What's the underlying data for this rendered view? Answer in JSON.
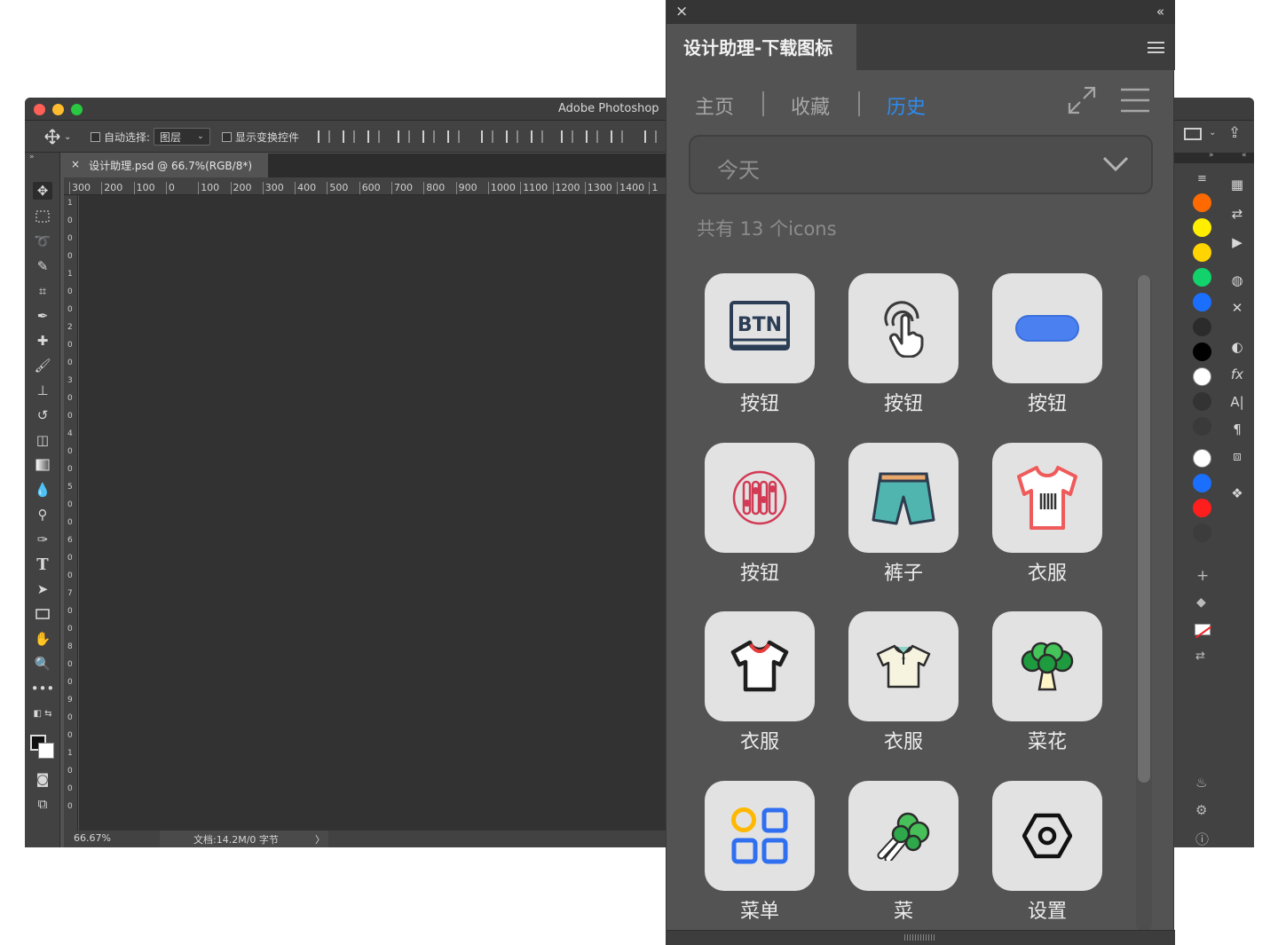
{
  "photoshop": {
    "app_title": "Adobe Photoshop",
    "options": {
      "auto_select_label": "自动选择:",
      "layer_select_value": "图层",
      "show_transform_label": "显示变换控件"
    },
    "doc_tab": {
      "close": "×",
      "title": "设计助理.psd @ 66.7%(RGB/8*)"
    },
    "ruler_ticks": [
      "300",
      "200",
      "100",
      "0",
      "100",
      "200",
      "300",
      "400",
      "500",
      "600",
      "700",
      "800",
      "900",
      "1000",
      "1100",
      "1200",
      "1300",
      "1400",
      "1"
    ],
    "left_ruler_digits": [
      "1",
      "0",
      "0",
      "0",
      "1",
      "0",
      "0",
      "2",
      "0",
      "0",
      "3",
      "0",
      "0",
      "4",
      "0",
      "0",
      "5",
      "0",
      "0",
      "6",
      "0",
      "0",
      "7",
      "0",
      "0",
      "8",
      "0",
      "0",
      "9",
      "0",
      "0",
      "1",
      "0",
      "0",
      "0"
    ],
    "status": {
      "zoom": "66.67%",
      "doc_size": "文档:14.2M/0 字节",
      "arrow": "〉"
    },
    "panel_collapse_left": "»",
    "panel_collapse_right": "«",
    "swatches": [
      "#ff6a00",
      "#ffee00",
      "#ffd400",
      "#12d36b",
      "#1b6fff",
      "#2b2b2b",
      "#000000",
      "#ffffff",
      "#333333",
      "#3a3a3a",
      "#ffffff",
      "#1b6fff",
      "#ff1e1e",
      "#3c3c3c"
    ]
  },
  "plugin": {
    "close": "×",
    "collapse": "«",
    "title": "设计助理-下载图标",
    "nav": {
      "home": "主页",
      "favorites": "收藏",
      "history": "历史",
      "active_color": "#2d8cf0"
    },
    "date_select_value": "今天",
    "count_text": "共有 13 个icons",
    "items": [
      {
        "label": "按钮",
        "icon": "btn-icon"
      },
      {
        "label": "按钮",
        "icon": "finger-touch-icon"
      },
      {
        "label": "按钮",
        "icon": "pill-button-icon"
      },
      {
        "label": "按钮",
        "icon": "equalizer-icon"
      },
      {
        "label": "裤子",
        "icon": "shorts-icon"
      },
      {
        "label": "衣服",
        "icon": "tshirt-icon"
      },
      {
        "label": "衣服",
        "icon": "black-tshirt-icon"
      },
      {
        "label": "衣服",
        "icon": "polo-shirt-icon"
      },
      {
        "label": "菜花",
        "icon": "broccoli-icon"
      },
      {
        "label": "菜单",
        "icon": "menu-grid-icon"
      },
      {
        "label": "菜",
        "icon": "cabbage-icon"
      },
      {
        "label": "设置",
        "icon": "settings-hex-icon"
      }
    ]
  }
}
